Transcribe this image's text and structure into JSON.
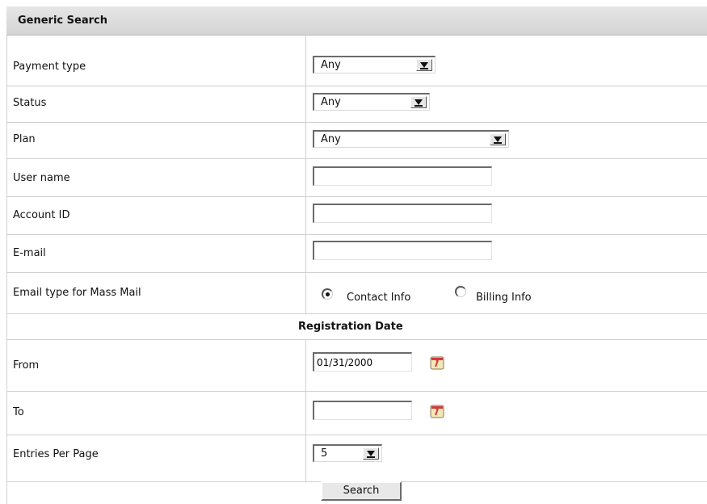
{
  "header": {
    "title": "Generic Search"
  },
  "fields": {
    "payment_type": {
      "label": "Payment type",
      "value": "Any"
    },
    "status": {
      "label": "Status",
      "value": "Any"
    },
    "plan": {
      "label": "Plan",
      "value": "Any"
    },
    "user_name": {
      "label": "User name",
      "value": ""
    },
    "account_id": {
      "label": "Account ID",
      "value": ""
    },
    "email": {
      "label": "E-mail",
      "value": ""
    },
    "email_type": {
      "label": "Email type for Mass Mail",
      "options": [
        {
          "label": "Contact Info",
          "selected": true
        },
        {
          "label": "Billing Info",
          "selected": false
        }
      ]
    }
  },
  "registration": {
    "section_title": "Registration Date",
    "from": {
      "label": "From",
      "value": "01/31/2000"
    },
    "to": {
      "label": "To",
      "value": ""
    }
  },
  "entries_per_page": {
    "label": "Entries Per Page",
    "value": "5"
  },
  "search_button": {
    "label": "Search"
  },
  "icons": {
    "calendar": "calendar-icon"
  }
}
